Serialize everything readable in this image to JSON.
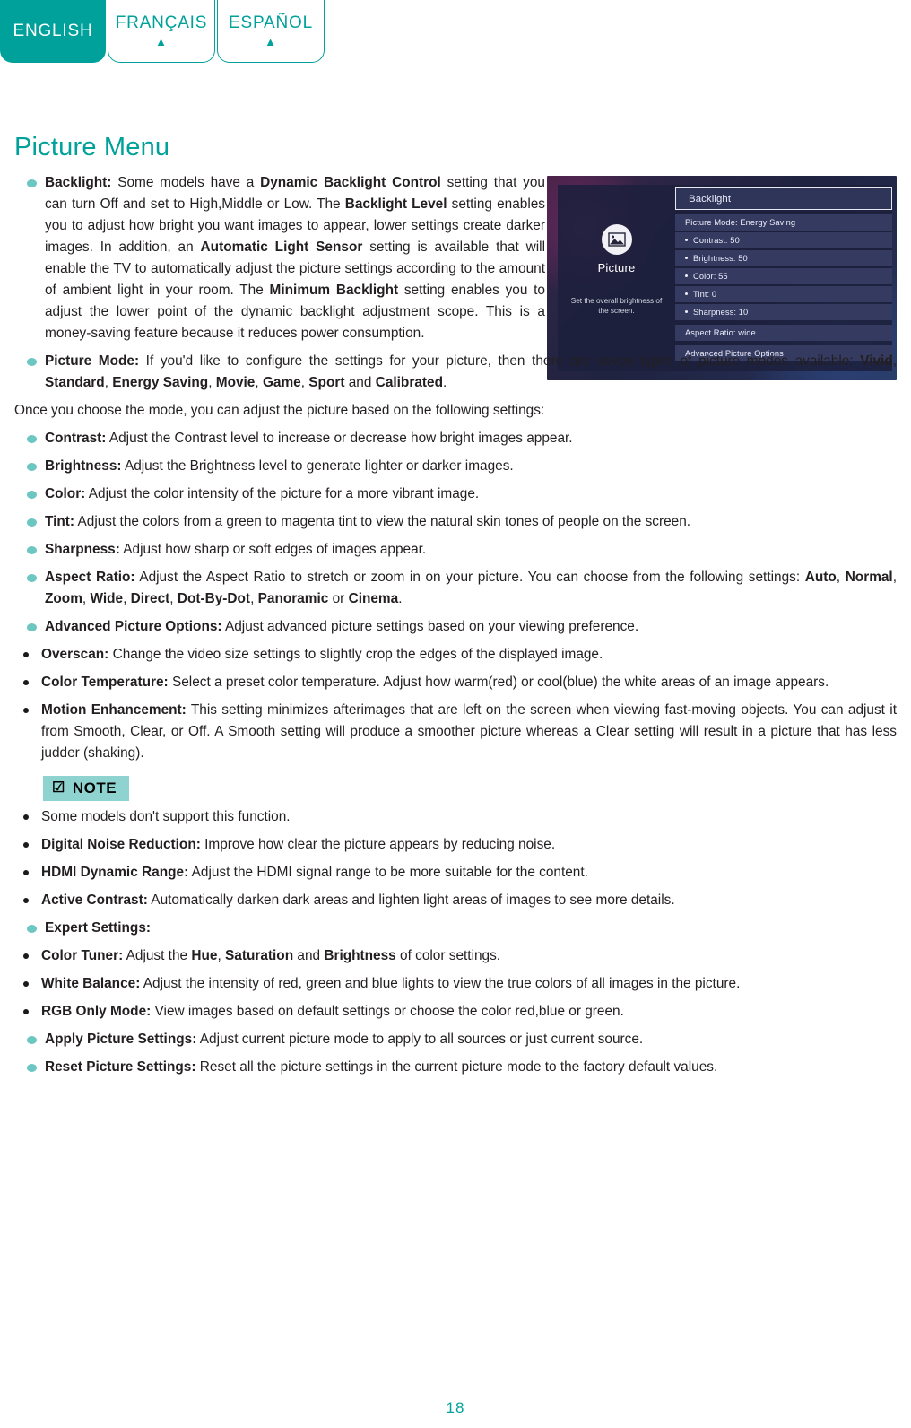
{
  "colors": {
    "accent": "#00a19a",
    "bullet": "#6cc6c2",
    "note_badge_bg": "#8fd3d1",
    "text": "#231f20"
  },
  "tabs": [
    {
      "label": "ENGLISH",
      "active": true,
      "arrow": ""
    },
    {
      "label": "FRANÇAIS",
      "active": false,
      "arrow": "▲"
    },
    {
      "label": "ESPAÑOL",
      "active": false,
      "arrow": "▲"
    }
  ],
  "page_title": "Picture Menu",
  "page_number": "18",
  "note_badge": {
    "label": "NOTE",
    "icon": "☑"
  },
  "sections": {
    "backlight": {
      "term": "Backlight:",
      "text_1": " Some models have a ",
      "bold_1": "Dynamic Backlight Control",
      "text_2": " setting that you can turn Off and set to High,Middle  or Low. The ",
      "bold_2": "Backlight Level",
      "text_3": " setting enables you to adjust how bright you want images to appear, lower settings create darker images. In addition, an ",
      "bold_3": "Automatic Light Sensor",
      "text_4": " setting is available that will enable the TV to automatically adjust the picture settings according to the amount of ambient light in your room. The ",
      "bold_4": "Minimum Backlight",
      "text_5": " setting enables you to adjust the lower point of the dynamic backlight adjustment scope. This is a money-saving feature because it reduces power consumption."
    },
    "picture_mode": {
      "term": "Picture Mode:",
      "text_1": " If you'd like to configure the settings for your picture, then there are seven types of picture modes available: ",
      "modes": [
        "Vivid",
        "Standard",
        "Energy Saving",
        "Movie",
        "Game",
        "Sport",
        "Calibrated"
      ],
      "conjunction": " and ",
      "end": "."
    },
    "once_you_choose": "Once you choose the mode, you can adjust the picture based on the following settings:",
    "contrast": {
      "term": "Contrast:",
      "text": " Adjust the Contrast level to increase or decrease how bright images appear."
    },
    "brightness": {
      "term": "Brightness:",
      "text": " Adjust the Brightness level to generate lighter or darker images."
    },
    "color": {
      "term": "Color:",
      "text": " Adjust the color intensity of the picture for a more vibrant image."
    },
    "tint": {
      "term": "Tint:",
      "text": " Adjust the colors from a green to magenta tint to view the natural skin tones of people on the screen."
    },
    "sharpness": {
      "term": "Sharpness:",
      "text": " Adjust how sharp or soft edges of images appear."
    },
    "aspect_ratio": {
      "term": "Aspect Ratio:",
      "text_1": " Adjust the Aspect Ratio to stretch or zoom in on your picture. You can choose from the following settings: ",
      "options": [
        "Auto",
        "Normal",
        "Zoom",
        "Wide",
        "Direct",
        "Dot-By-Dot",
        "Panoramic",
        "Cinema"
      ],
      "conjunction": " or ",
      "end": "."
    },
    "advanced_picture_options": {
      "term": "Advanced Picture Options:",
      "text": " Adjust advanced picture settings based on your viewing preference."
    },
    "overscan": {
      "term": "Overscan:",
      "text": " Change the video size settings to slightly crop the edges of the displayed image."
    },
    "color_temperature": {
      "term": "Color Temperature:",
      "text": " Select a preset color temperature. Adjust how warm(red) or cool(blue) the white areas of an image appears."
    },
    "motion_enhancement": {
      "term": "Motion Enhancement:",
      "text": " This setting minimizes afterimages that are left on the screen when viewing fast-moving objects. You can adjust it from Smooth, Clear, or Off. A Smooth setting will produce a smoother picture whereas a Clear setting will result in a picture that has less judder (shaking)."
    },
    "note_item": "Some models don't support this function.",
    "digital_noise_reduction": {
      "term": "Digital Noise Reduction:",
      "text": " Improve how clear the picture appears by reducing noise."
    },
    "hdmi_dynamic_range": {
      "term": "HDMI Dynamic Range:",
      "text": " Adjust the HDMI signal range to be more suitable for the content."
    },
    "active_contrast": {
      "term": "Active Contrast:",
      "text": " Automatically darken dark areas and lighten light areas of images to see more details."
    },
    "expert_settings": {
      "term": "Expert Settings:"
    },
    "color_tuner": {
      "term": "Color Tuner:",
      "text_1": " Adjust the ",
      "bold_1": "Hue",
      "text_2": ", ",
      "bold_2": "Saturation",
      "text_3": " and ",
      "bold_3": "Brightness",
      "text_4": " of color settings."
    },
    "white_balance": {
      "term": "White Balance:",
      "text": " Adjust the intensity of red, green and blue lights to view the true colors of all images in the picture."
    },
    "rgb_only_mode": {
      "term": "RGB Only Mode:",
      "text": " View images based on default settings or choose the color red,blue or green."
    },
    "apply_picture_settings": {
      "term": "Apply Picture Settings:",
      "text": " Adjust current picture mode to apply to all sources or just current source."
    },
    "reset_picture_settings": {
      "term": "Reset Picture Settings:",
      "text": " Reset all the picture settings in the current picture mode to the factory default values."
    }
  },
  "tv_menu": {
    "icon_name": "picture-icon",
    "left_title": "Picture",
    "left_description": "Set the overall brightness of the screen.",
    "header_row": "Backlight",
    "rows": [
      {
        "label": "Picture Mode: Energy Saving",
        "bulleted": false
      },
      {
        "label": "Contrast: 50",
        "bulleted": true
      },
      {
        "label": "Brightness: 50",
        "bulleted": true
      },
      {
        "label": "Color: 55",
        "bulleted": true
      },
      {
        "label": "Tint: 0",
        "bulleted": true
      },
      {
        "label": "Sharpness: 10",
        "bulleted": true
      },
      {
        "label": "Aspect Ratio: wide",
        "bulleted": false
      },
      {
        "label": "Advanced Picture Options",
        "bulleted": false
      }
    ]
  }
}
